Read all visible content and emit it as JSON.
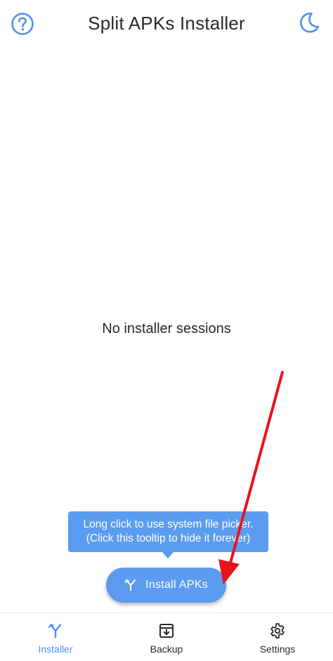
{
  "header": {
    "title": "Split APKs Installer",
    "help_icon": "help-circle-icon",
    "theme_icon": "moon-icon"
  },
  "main": {
    "empty_message": "No installer sessions"
  },
  "tooltip": {
    "line1": "Long click to use system file picker.",
    "line2": "(Click this tooltip to hide it forever)"
  },
  "fab": {
    "label": "Install APKs",
    "icon": "split-icon"
  },
  "bottom_nav": {
    "items": [
      {
        "label": "Installer",
        "icon": "split-icon",
        "active": true
      },
      {
        "label": "Backup",
        "icon": "archive-download-icon",
        "active": false
      },
      {
        "label": "Settings",
        "icon": "gear-icon",
        "active": false
      }
    ]
  },
  "colors": {
    "accent": "#5c9cf0",
    "active_nav": "#4f8ff0",
    "annotation_arrow": "#e8141c"
  }
}
